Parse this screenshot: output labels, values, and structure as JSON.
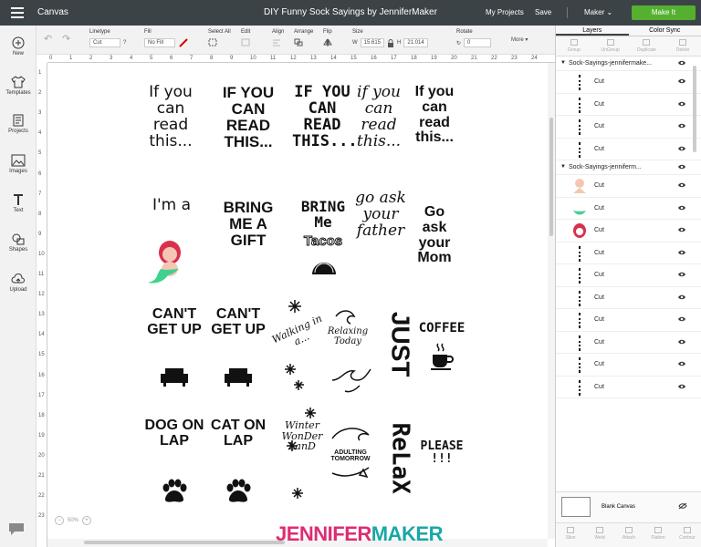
{
  "topbar": {
    "canvas_label": "Canvas",
    "doc_title": "DIY Funny Sock Sayings by JenniferMaker",
    "my_projects": "My Projects",
    "save": "Save",
    "machine": "Maker",
    "make_it": "Make It"
  },
  "toolbar": {
    "linetype_label": "Linetype",
    "linetype_value": "Cut",
    "fill_label": "Fill",
    "fill_value": "No Fill",
    "select_all": "Select All",
    "edit": "Edit",
    "align": "Align",
    "arrange": "Arrange",
    "flip": "Flip",
    "size_label": "Size",
    "width_label": "W",
    "width_value": "15.615",
    "height_label": "H",
    "height_value": "21.014",
    "rotate_label": "Rotate",
    "rotate_value": "0",
    "more": "More"
  },
  "leftnav": [
    {
      "label": "New"
    },
    {
      "label": "Templates"
    },
    {
      "label": "Projects"
    },
    {
      "label": "Images"
    },
    {
      "label": "Text"
    },
    {
      "label": "Shapes"
    },
    {
      "label": "Upload"
    }
  ],
  "ruler": {
    "top": [
      "0",
      "1",
      "2",
      "3",
      "4",
      "5",
      "6",
      "7",
      "8",
      "9",
      "10",
      "11",
      "12",
      "13",
      "14",
      "15",
      "16",
      "17",
      "18",
      "19",
      "20",
      "21",
      "22",
      "23",
      "24"
    ],
    "left": [
      "1",
      "2",
      "3",
      "4",
      "5",
      "6",
      "7",
      "8",
      "9",
      "10",
      "11",
      "12",
      "13",
      "14",
      "15",
      "16",
      "17",
      "18",
      "19",
      "20",
      "21",
      "22",
      "23"
    ]
  },
  "designs": {
    "r1": [
      "If you can read this...",
      "IF YOU CAN READ THIS...",
      "IF YOU CAN READ THIS...",
      "if you can read this...",
      "If you can read this..."
    ],
    "r2_1": "I'm a",
    "r2_2": "BRING ME A GIFT",
    "r2_3a": "BRING Me",
    "r2_3b": "Tacos",
    "r2_4": "go ask your father",
    "r2_5": "Go ask your Mom",
    "r3_1": "CAN'T GET UP",
    "r3_2": "CAN'T GET UP",
    "r3_3a": "Walking in a...",
    "r3_3b": "Relaxing Today",
    "r3_4": "JUST",
    "r3_5": "COFFEE",
    "r4_1": "DOG ON LAP",
    "r4_2": "CAT ON LAP",
    "r4_3a": "Winter WonDer LanD",
    "r4_3b": "ADULTING TOMORROW",
    "r4_4": "ReLaX",
    "r4_5": "PLEASE !!!"
  },
  "zoom": {
    "value": "50%"
  },
  "watermark": {
    "a": "JENNIFER",
    "b": "MAKER"
  },
  "panel": {
    "tabs": [
      "Layers",
      "Color Sync"
    ],
    "tools": [
      "Group",
      "UnGroup",
      "Duplicate",
      "Delete"
    ],
    "group1": "Sock-Sayings-jennifermake...",
    "group2": "Sock-Sayings-jenniferm...",
    "layer_label": "Cut",
    "blank_canvas": "Blank Canvas",
    "bottom_tools": [
      "Slice",
      "Weld",
      "Attach",
      "Flatten",
      "Contour"
    ]
  }
}
